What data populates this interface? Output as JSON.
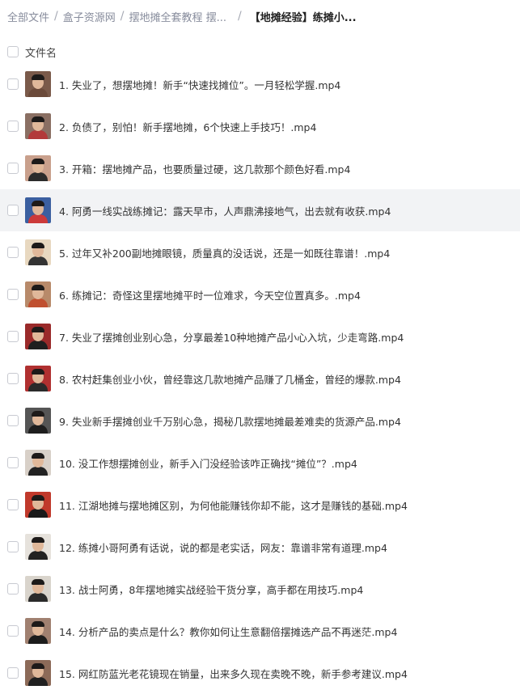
{
  "breadcrumb": {
    "items": [
      "全部文件",
      "盒子资源网",
      "摆地摊全套教程 摆..."
    ],
    "current": "【地摊经验】练摊小..."
  },
  "header": {
    "column_label": "文件名"
  },
  "files": [
    {
      "name": "1. 失业了，想摆地摊！新手“快速找摊位”。一月轻松学握.mp4",
      "thumb_bg": "#7a5a4a",
      "thumb_body": "#6b4a3a"
    },
    {
      "name": "2. 负债了，别怕！新手摆地摊，6个快速上手技巧！.mp4",
      "thumb_bg": "#8a6f63",
      "thumb_body": "#b23a3a"
    },
    {
      "name": "3. 开箱：摆地摊产品，也要质量过硬，这几款那个颜色好看.mp4",
      "thumb_bg": "#c9a08c",
      "thumb_body": "#2b2b2b"
    },
    {
      "name": "4. 阿勇一线实战练摊记：露天早市，人声鼎沸接地气，出去就有收获.mp4",
      "thumb_bg": "#3b5fa0",
      "thumb_body": "#cc3a3a"
    },
    {
      "name": "5. 过年又补200副地摊眼镜，质量真的没话说，还是一如既往靠谱！.mp4",
      "thumb_bg": "#e8d8c0",
      "thumb_body": "#333333"
    },
    {
      "name": "6. 练摊记：奇怪这里摆地摊平时一位难求，今天空位置真多。.mp4",
      "thumb_bg": "#b88a6a",
      "thumb_body": "#c05030"
    },
    {
      "name": "7. 失业了摆摊创业别心急，分享最差10种地摊产品小心入坑，少走弯路.mp4",
      "thumb_bg": "#9a2a2a",
      "thumb_body": "#1f1f1f"
    },
    {
      "name": "8. 农村赶集创业小伙，曾经靠这几款地摊产品赚了几桶金，曾经的爆款.mp4",
      "thumb_bg": "#b03030",
      "thumb_body": "#2a2a2a"
    },
    {
      "name": "9. 失业新手摆摊创业千万别心急，揭秘几款摆地摊最差难卖的货源产品.mp4",
      "thumb_bg": "#555555",
      "thumb_body": "#1e1e1e"
    },
    {
      "name": "10. 没工作想摆摊创业，新手入门没经验该咋正确找“摊位”？.mp4",
      "thumb_bg": "#d8d0c8",
      "thumb_body": "#222222"
    },
    {
      "name": "11. 江湖地摊与摆地摊区别，为何他能赚钱你却不能，这才是赚钱的基础.mp4",
      "thumb_bg": "#c0392b",
      "thumb_body": "#1a1a1a"
    },
    {
      "name": "12. 练摊小哥阿勇有话说，说的都是老实话，网友：靠谱非常有道理.mp4",
      "thumb_bg": "#e6e2dc",
      "thumb_body": "#222222"
    },
    {
      "name": "13. 战士阿勇，8年摆地摊实战经验干货分享，高手都在用技巧.mp4",
      "thumb_bg": "#d9d4cc",
      "thumb_body": "#2a2a2a"
    },
    {
      "name": "14. 分析产品的卖点是什么？教你如何让生意翻倍摆摊选产品不再迷茫.mp4",
      "thumb_bg": "#a08070",
      "thumb_body": "#1c1c1c"
    },
    {
      "name": "15. 网红防蓝光老花镜现在销量，出来多久现在卖晚不晚，新手参考建议.mp4",
      "thumb_bg": "#8c6a58",
      "thumb_body": "#202020"
    }
  ],
  "hover_row_index": 3
}
